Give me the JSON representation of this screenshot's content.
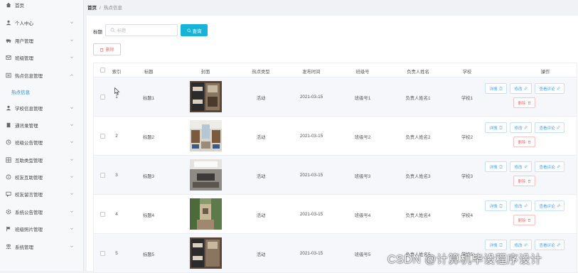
{
  "sidebar": {
    "items": [
      {
        "label": "首页",
        "icon": "home-icon",
        "arrow": false
      },
      {
        "label": "个人中心",
        "icon": "user-icon",
        "arrow": true
      },
      {
        "label": "用户管理",
        "icon": "truck-icon",
        "arrow": true
      },
      {
        "label": "班级管理",
        "icon": "mail-icon",
        "arrow": true
      },
      {
        "label": "热点信息管理",
        "icon": "list-icon",
        "arrow": true
      },
      {
        "label": "热点信息",
        "icon": "",
        "arrow": false,
        "sub": true
      },
      {
        "label": "学校信息管理",
        "icon": "user-icon",
        "arrow": true
      },
      {
        "label": "通讯录管理",
        "icon": "book-icon",
        "arrow": true
      },
      {
        "label": "班级公告管理",
        "icon": "clock-icon",
        "arrow": true
      },
      {
        "label": "互助类型管理",
        "icon": "grid-icon",
        "arrow": true
      },
      {
        "label": "校友互助管理",
        "icon": "info-icon",
        "arrow": true
      },
      {
        "label": "校友留言管理",
        "icon": "chat-icon",
        "arrow": true
      },
      {
        "label": "系统公告管理",
        "icon": "gear-icon",
        "arrow": true
      },
      {
        "label": "班级照片管理",
        "icon": "flag-icon",
        "arrow": true
      },
      {
        "label": "系统管理",
        "icon": "people-icon",
        "arrow": true
      }
    ]
  },
  "breadcrumb": {
    "home": "首页",
    "separator": "/",
    "current": "热点信息"
  },
  "filter": {
    "label": "标题",
    "placeholder": "标题",
    "query_label": "查询",
    "delete_label": "删除"
  },
  "table": {
    "headers": [
      "索引",
      "标题",
      "封面",
      "热点类型",
      "发布时间",
      "班级号",
      "负责人姓名",
      "学校",
      "操作"
    ],
    "rows": [
      {
        "index": "1",
        "title": "标题1",
        "type": "活动",
        "time": "2021-03-15",
        "class_no": "班级号1",
        "owner": "负责人姓名1",
        "school": "学校1"
      },
      {
        "index": "2",
        "title": "标题2",
        "type": "活动",
        "time": "2021-03-15",
        "class_no": "班级号2",
        "owner": "负责人姓名2",
        "school": "学校2"
      },
      {
        "index": "3",
        "title": "标题3",
        "type": "活动",
        "time": "2021-03-15",
        "class_no": "班级号3",
        "owner": "负责人姓名3",
        "school": "学校3"
      },
      {
        "index": "4",
        "title": "标题4",
        "type": "活动",
        "time": "2021-03-15",
        "class_no": "班级号4",
        "owner": "负责人姓名4",
        "school": "学校4"
      },
      {
        "index": "5",
        "title": "标题5",
        "type": "活动",
        "time": "2021-03-15",
        "class_no": "班级号5",
        "owner": "负责人姓名5",
        "school": "学校5"
      }
    ],
    "actions": {
      "detail": "详情",
      "edit": "修改",
      "comments": "查看评论",
      "delete": "删除"
    }
  },
  "watermark": "CSDN @计算机毕设程序设计",
  "colors": {
    "accent": "#17b3d8",
    "link": "#409eff",
    "danger": "#f56c6c",
    "active_menu": "#2a8ad8"
  }
}
